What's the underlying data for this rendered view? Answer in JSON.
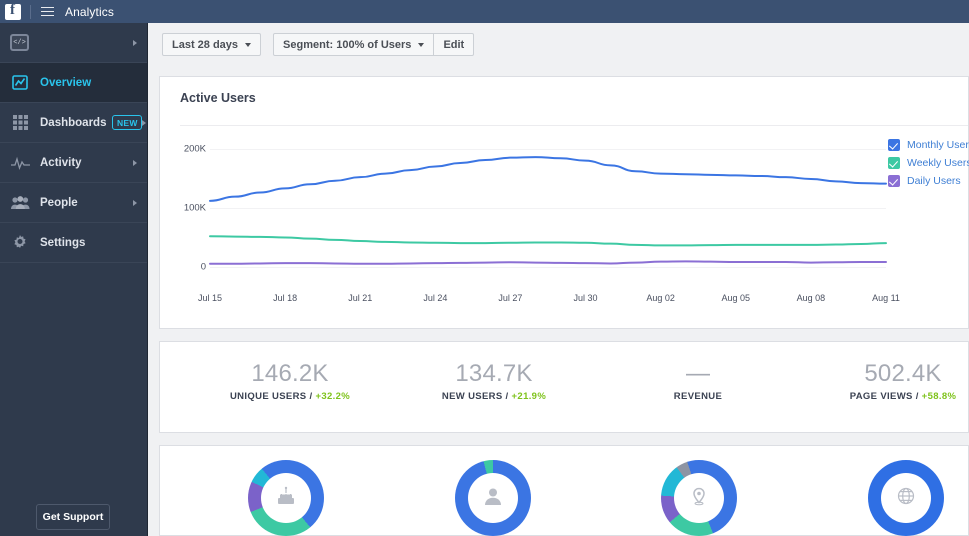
{
  "topbar": {
    "title": "Analytics",
    "logo": "facebook-logo",
    "menu_icon": "hamburger-icon"
  },
  "sidebar": {
    "app_icon": "code-window-icon",
    "app_code": "</>",
    "items": [
      {
        "label": "Overview",
        "icon": "chart-line-icon",
        "active": true,
        "arrow": false,
        "badge": null
      },
      {
        "label": "Dashboards",
        "icon": "grid-icon",
        "active": false,
        "arrow": true,
        "badge": "NEW"
      },
      {
        "label": "Activity",
        "icon": "pulse-icon",
        "active": false,
        "arrow": true,
        "badge": null
      },
      {
        "label": "People",
        "icon": "people-icon",
        "active": false,
        "arrow": true,
        "badge": null
      },
      {
        "label": "Settings",
        "icon": "gear-icon",
        "active": false,
        "arrow": false,
        "badge": null
      }
    ],
    "support_button": "Get Support"
  },
  "toolbar": {
    "date_range": "Last 28 days",
    "segment": "Segment: 100% of Users",
    "edit": "Edit"
  },
  "chart_card": {
    "title": "Active Users"
  },
  "chart_data": {
    "type": "line",
    "title": "Active Users",
    "xlabel": "",
    "ylabel": "",
    "ylim": [
      0,
      220000
    ],
    "yticks": [
      0,
      100000,
      200000
    ],
    "ytick_labels": [
      "0",
      "100K",
      "200K"
    ],
    "grid": true,
    "legend_position": "right",
    "x": [
      "Jul 15",
      "Jul 16",
      "Jul 17",
      "Jul 18",
      "Jul 19",
      "Jul 20",
      "Jul 21",
      "Jul 22",
      "Jul 23",
      "Jul 24",
      "Jul 25",
      "Jul 26",
      "Jul 27",
      "Jul 28",
      "Jul 29",
      "Jul 30",
      "Jul 31",
      "Aug 01",
      "Aug 02",
      "Aug 03",
      "Aug 04",
      "Aug 05",
      "Aug 06",
      "Aug 07",
      "Aug 08",
      "Aug 09",
      "Aug 10",
      "Aug 11"
    ],
    "xtick_labels": [
      "Jul 15",
      "Jul 18",
      "Jul 21",
      "Jul 24",
      "Jul 27",
      "Jul 30",
      "Aug 02",
      "Aug 05",
      "Aug 08",
      "Aug 11"
    ],
    "series": [
      {
        "name": "Monthly Users",
        "color": "#3b75e3",
        "values": [
          112000,
          119000,
          126000,
          133000,
          140000,
          146000,
          152000,
          158000,
          164000,
          170000,
          176000,
          181000,
          185000,
          186000,
          184000,
          180000,
          172000,
          162000,
          158000,
          157000,
          156000,
          155000,
          154000,
          152000,
          149000,
          145000,
          142000,
          141000
        ]
      },
      {
        "name": "Weekly Users",
        "color": "#3dc9a3",
        "values": [
          52000,
          51500,
          51000,
          50000,
          48000,
          46000,
          44000,
          42500,
          41500,
          41000,
          40500,
          40500,
          41000,
          41500,
          41500,
          41000,
          39500,
          37500,
          36500,
          36500,
          37000,
          37500,
          37500,
          37500,
          37500,
          38000,
          39000,
          40500
        ]
      },
      {
        "name": "Daily Users",
        "color": "#8b6fd4",
        "values": [
          5500,
          5500,
          6000,
          6500,
          6500,
          6000,
          5500,
          5500,
          6000,
          6500,
          7000,
          7500,
          8000,
          7500,
          7000,
          6500,
          6000,
          7500,
          9000,
          9500,
          9000,
          8500,
          8500,
          8500,
          7500,
          8000,
          8500,
          8500
        ]
      }
    ]
  },
  "kpis": [
    {
      "value": "146.2K",
      "label": "UNIQUE USERS",
      "delta": "+32.2%",
      "has_value": true
    },
    {
      "value": "134.7K",
      "label": "NEW USERS",
      "delta": "+21.9%",
      "has_value": true
    },
    {
      "value": "—",
      "label": "REVENUE",
      "delta": null,
      "has_value": false
    },
    {
      "value": "502.4K",
      "label": "PAGE VIEWS",
      "delta": "+58.8%",
      "has_value": true
    }
  ],
  "donuts": [
    {
      "icon": "birthday-cake-icon",
      "segments": [
        {
          "color": "#3b75e3",
          "pct": 39
        },
        {
          "color": "#3dc9a3",
          "pct": 30
        },
        {
          "color": "#7b62c9",
          "pct": 13
        },
        {
          "color": "#22b8d6",
          "pct": 7
        },
        {
          "color": "#3b75e3",
          "pct": 11
        }
      ]
    },
    {
      "icon": "person-icon",
      "segments": [
        {
          "color": "#3b75e3",
          "pct": 96
        },
        {
          "color": "#3dc9a3",
          "pct": 4
        }
      ]
    },
    {
      "icon": "location-pin-icon",
      "segments": [
        {
          "color": "#3b75e3",
          "pct": 44
        },
        {
          "color": "#3dc9a3",
          "pct": 20
        },
        {
          "color": "#7b62c9",
          "pct": 12
        },
        {
          "color": "#22b8d6",
          "pct": 14
        },
        {
          "color": "#8d94a3",
          "pct": 5
        },
        {
          "color": "#3b75e3",
          "pct": 5
        }
      ]
    },
    {
      "icon": "globe-icon",
      "segments": [
        {
          "color": "#2f6fe4",
          "pct": 100
        }
      ]
    }
  ],
  "colors": {
    "topbar": "#3b5172",
    "sidebar": "#2f3a4c",
    "sidebar_active": "#242d3b",
    "accent_cyan": "#2ac4ec",
    "positive": "#7fc31c",
    "link_blue": "#3f7fd4"
  }
}
